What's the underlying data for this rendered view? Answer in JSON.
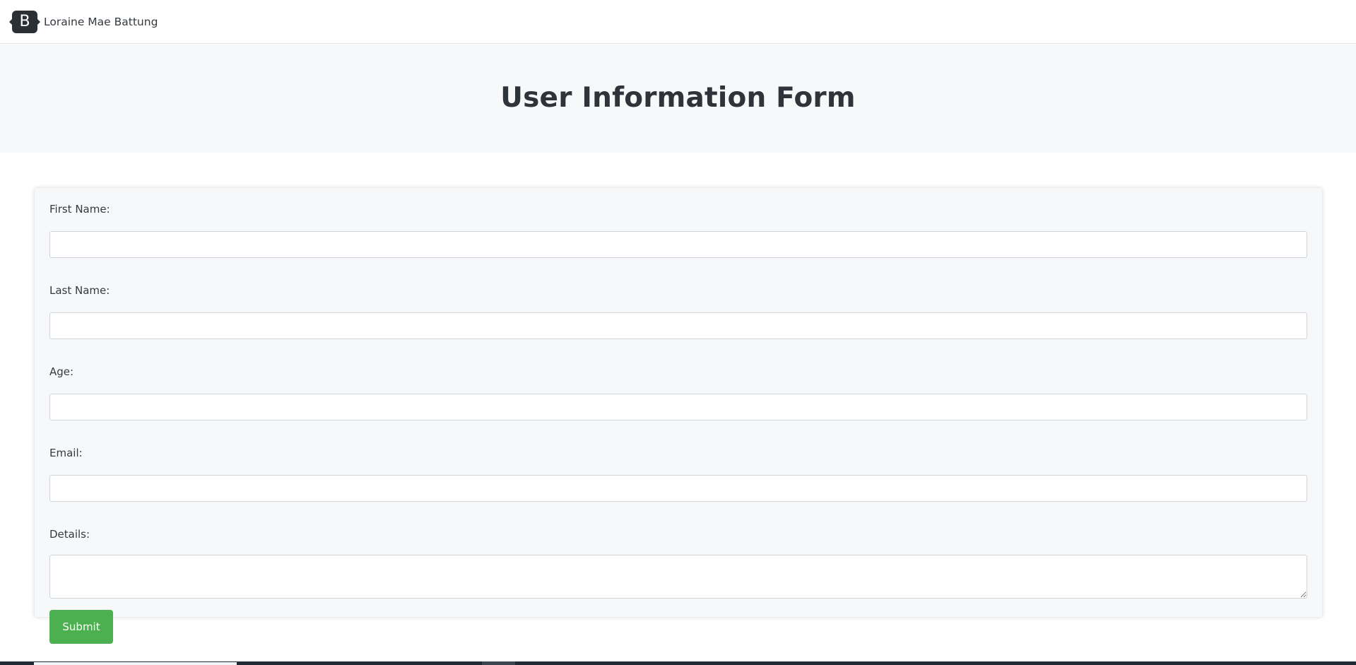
{
  "navbar": {
    "logo_letter": "B",
    "brand_name": "Loraine Mae Battung"
  },
  "hero": {
    "title": "User Information Form"
  },
  "form": {
    "fields": [
      {
        "label": "First Name:",
        "value": ""
      },
      {
        "label": "Last Name:",
        "value": ""
      },
      {
        "label": "Age:",
        "value": ""
      },
      {
        "label": "Email:",
        "value": ""
      }
    ],
    "details": {
      "label": "Details:",
      "value": ""
    },
    "submit_label": "Submit"
  },
  "colors": {
    "submit_button": "#4caf50",
    "hero_background": "#f7f8f9",
    "logo_background": "#2b3036"
  },
  "icons": {
    "brand_logo": "bootstrap-logo-icon"
  }
}
